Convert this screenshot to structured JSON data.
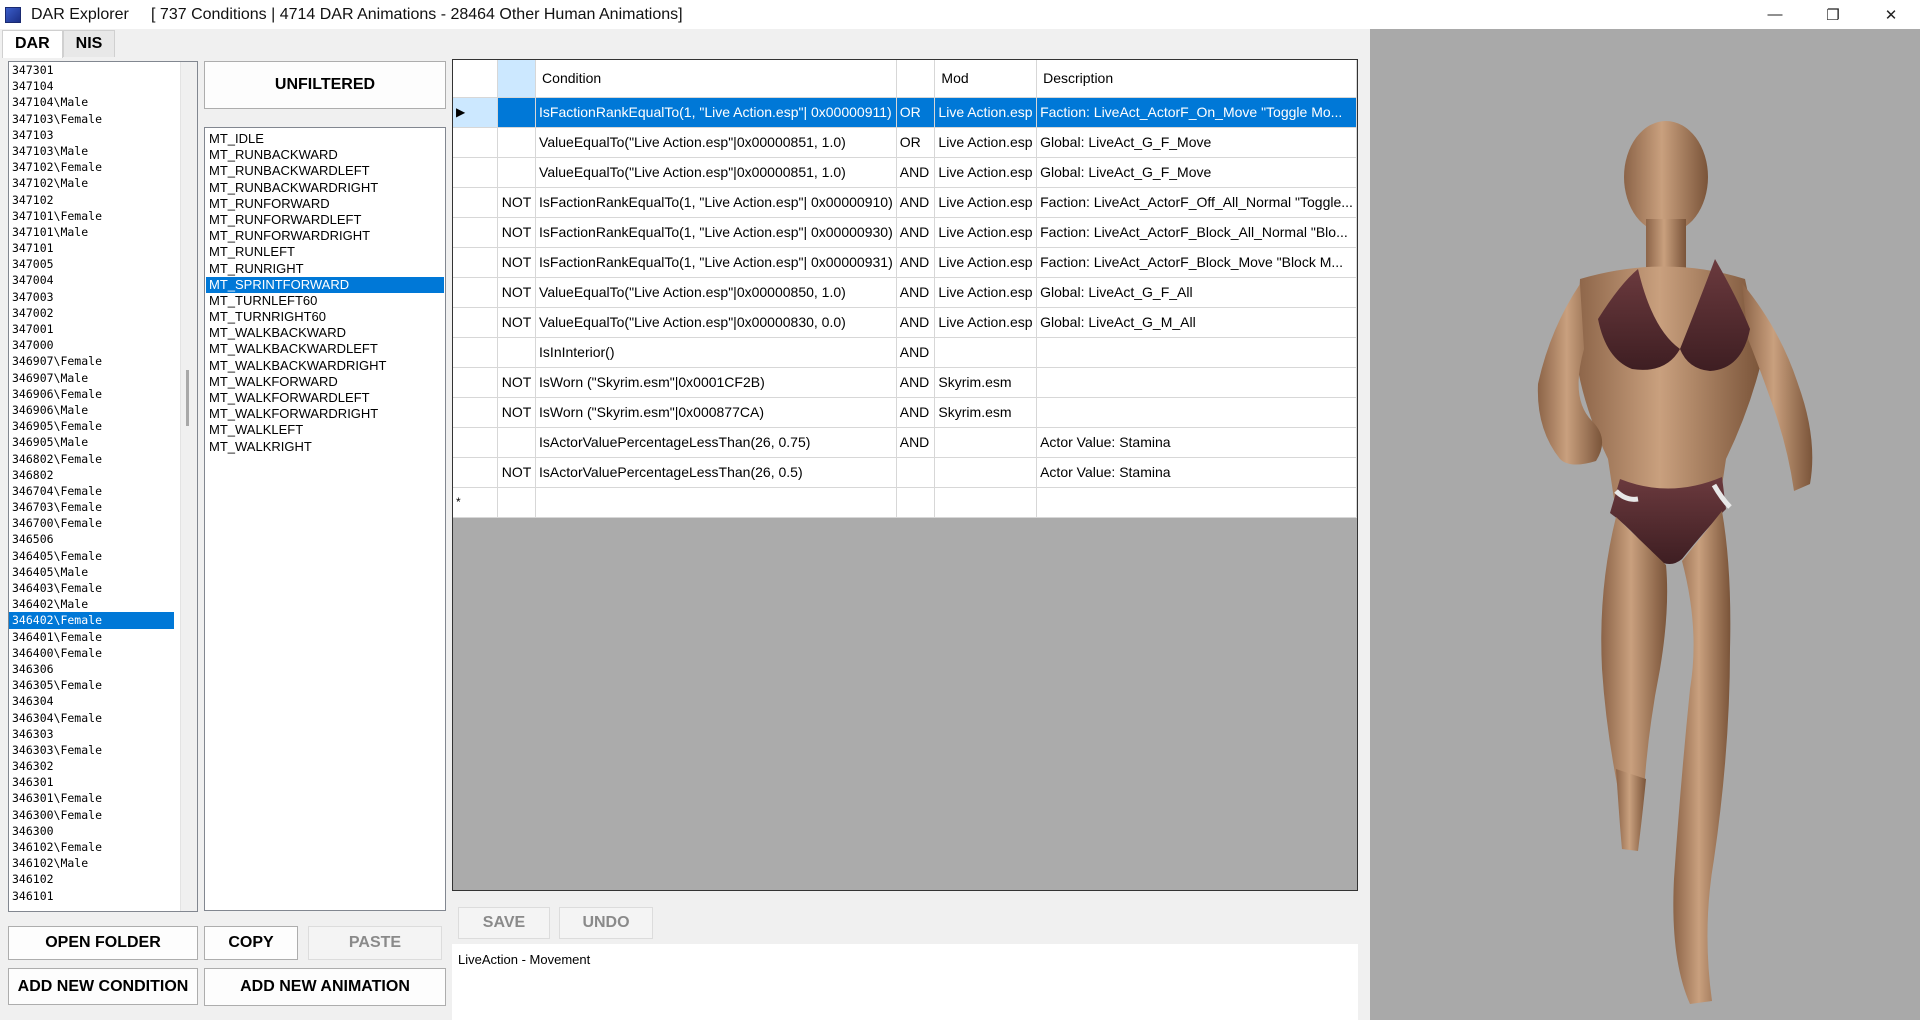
{
  "window": {
    "title": "DAR Explorer     [ 737 Conditions | 4714 DAR Animations - 28464 Other Human Animations]",
    "minimize": "—",
    "restore": "❐",
    "close": "✕"
  },
  "tabs": [
    "DAR",
    "NIS"
  ],
  "left_list": [
    "347301",
    "347104",
    "347104\\Male",
    "347103\\Female",
    "347103",
    "347103\\Male",
    "347102\\Female",
    "347102\\Male",
    "347102",
    "347101\\Female",
    "347101\\Male",
    "347101",
    "347005",
    "347004",
    "347003",
    "347002",
    "347001",
    "347000",
    "346907\\Female",
    "346907\\Male",
    "346906\\Female",
    "346906\\Male",
    "346905\\Female",
    "346905\\Male",
    "346802\\Female",
    "346802",
    "346704\\Female",
    "346703\\Female",
    "346700\\Female",
    "346506",
    "346405\\Female",
    "346405\\Male",
    "346403\\Female",
    "346402\\Male",
    "346402\\Female",
    "346401\\Female",
    "346400\\Female",
    "346306",
    "346305\\Female",
    "346304",
    "346304\\Female",
    "346303",
    "346303\\Female",
    "346302",
    "346301",
    "346301\\Female",
    "346300\\Female",
    "346300",
    "346102\\Female",
    "346102\\Male",
    "346102",
    "346101"
  ],
  "left_selected": "346402\\Female",
  "filter_button": "UNFILTERED",
  "mid_list": [
    "MT_IDLE",
    "MT_RUNBACKWARD",
    "MT_RUNBACKWARDLEFT",
    "MT_RUNBACKWARDRIGHT",
    "MT_RUNFORWARD",
    "MT_RUNFORWARDLEFT",
    "MT_RUNFORWARDRIGHT",
    "MT_RUNLEFT",
    "MT_RUNRIGHT",
    "MT_SPRINTFORWARD",
    "MT_TURNLEFT60",
    "MT_TURNRIGHT60",
    "MT_WALKBACKWARD",
    "MT_WALKBACKWARDLEFT",
    "MT_WALKBACKWARDRIGHT",
    "MT_WALKFORWARD",
    "MT_WALKFORWARDLEFT",
    "MT_WALKFORWARDRIGHT",
    "MT_WALKLEFT",
    "MT_WALKRIGHT"
  ],
  "mid_selected": "MT_SPRINTFORWARD",
  "grid": {
    "columns": [
      "",
      "",
      "Condition",
      "",
      "Mod",
      "Description"
    ],
    "row_indicator": "▶",
    "new_row_marker": "*",
    "rows": [
      {
        "not": "",
        "condition": "IsFactionRankEqualTo(1, \"Live Action.esp\"| 0x00000911)",
        "op": "OR",
        "mod": "Live Action.esp",
        "description": "Faction: LiveAct_ActorF_On_Move \"Toggle Mo..."
      },
      {
        "not": "",
        "condition": "ValueEqualTo(\"Live Action.esp\"|0x00000851, 1.0)",
        "op": "OR",
        "mod": "Live Action.esp",
        "description": "Global: LiveAct_G_F_Move"
      },
      {
        "not": "",
        "condition": "ValueEqualTo(\"Live Action.esp\"|0x00000851, 1.0)",
        "op": "AND",
        "mod": "Live Action.esp",
        "description": "Global: LiveAct_G_F_Move"
      },
      {
        "not": "NOT",
        "condition": "IsFactionRankEqualTo(1, \"Live Action.esp\"| 0x00000910)",
        "op": "AND",
        "mod": "Live Action.esp",
        "description": "Faction: LiveAct_ActorF_Off_All_Normal \"Toggle..."
      },
      {
        "not": "NOT",
        "condition": "IsFactionRankEqualTo(1, \"Live Action.esp\"| 0x00000930)",
        "op": "AND",
        "mod": "Live Action.esp",
        "description": "Faction: LiveAct_ActorF_Block_All_Normal \"Blo..."
      },
      {
        "not": "NOT",
        "condition": "IsFactionRankEqualTo(1, \"Live Action.esp\"| 0x00000931)",
        "op": "AND",
        "mod": "Live Action.esp",
        "description": "Faction: LiveAct_ActorF_Block_Move \"Block M..."
      },
      {
        "not": "NOT",
        "condition": "ValueEqualTo(\"Live Action.esp\"|0x00000850, 1.0)",
        "op": "AND",
        "mod": "Live Action.esp",
        "description": "Global: LiveAct_G_F_All"
      },
      {
        "not": "NOT",
        "condition": "ValueEqualTo(\"Live Action.esp\"|0x00000830, 0.0)",
        "op": "AND",
        "mod": "Live Action.esp",
        "description": "Global: LiveAct_G_M_All"
      },
      {
        "not": "",
        "condition": "IsInInterior()",
        "op": "AND",
        "mod": "",
        "description": ""
      },
      {
        "not": "NOT",
        "condition": "IsWorn (\"Skyrim.esm\"|0x0001CF2B)",
        "op": "AND",
        "mod": "Skyrim.esm",
        "description": ""
      },
      {
        "not": "NOT",
        "condition": "IsWorn (\"Skyrim.esm\"|0x000877CA)",
        "op": "AND",
        "mod": "Skyrim.esm",
        "description": ""
      },
      {
        "not": "",
        "condition": "IsActorValuePercentageLessThan(26, 0.75)",
        "op": "AND",
        "mod": "",
        "description": "Actor Value: Stamina"
      },
      {
        "not": "NOT",
        "condition": "IsActorValuePercentageLessThan(26, 0.5)",
        "op": "",
        "mod": "",
        "description": "Actor Value: Stamina"
      }
    ]
  },
  "buttons": {
    "save": "SAVE",
    "undo": "UNDO",
    "open_folder": "OPEN FOLDER",
    "copy": "COPY",
    "paste": "PASTE",
    "add_condition": "ADD NEW CONDITION",
    "add_animation": "ADD NEW ANIMATION"
  },
  "status_text": "LiveAction - Movement",
  "colors": {
    "selection": "#0078d7",
    "viewport_bg": "#a9a9a9",
    "grid_bg": "#ababab"
  }
}
